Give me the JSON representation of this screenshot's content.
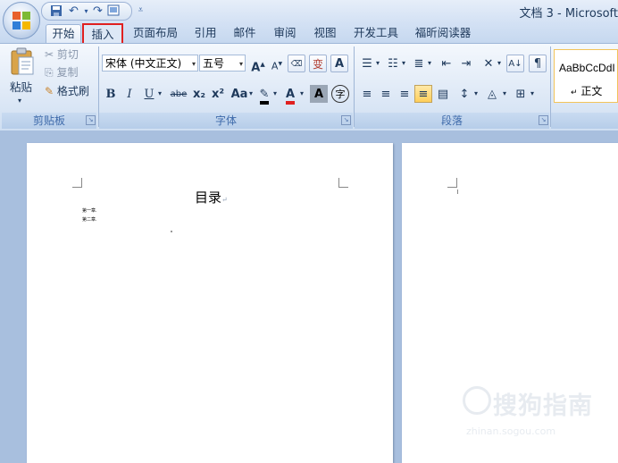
{
  "window": {
    "title": "文档 3 - Microsoft"
  },
  "tabs": [
    "开始",
    "插入",
    "页面布局",
    "引用",
    "邮件",
    "审阅",
    "视图",
    "开发工具",
    "福昕阅读器"
  ],
  "clipboard": {
    "paste": "粘贴",
    "cut": "剪切",
    "copy": "复制",
    "format_painter": "格式刷",
    "group_label": "剪贴板"
  },
  "font": {
    "font_name": "宋体 (中文正文)",
    "font_size": "五号",
    "group_label": "字体",
    "bold": "B",
    "italic": "I",
    "underline": "U",
    "strike": "abe",
    "subscript": "x₂",
    "superscript": "x²",
    "change_case": "Aa",
    "grow": "A",
    "shrink": "A",
    "phonetic": "变",
    "border_char": "A",
    "shading_char": "A",
    "enclose_char": "字"
  },
  "paragraph": {
    "group_label": "段落"
  },
  "styles": {
    "preview": "AaBbCcDdI",
    "name": "正文"
  },
  "document": {
    "title": "目录",
    "toc_lines": [
      "第一章.",
      "第二章."
    ]
  },
  "watermark": {
    "text": "搜狗指南",
    "url": "zhinan.sogou.com"
  },
  "colors": {
    "highlight_box": "#e02020",
    "ribbon": "#dfe9f7",
    "workspace": "#a8bfde"
  }
}
